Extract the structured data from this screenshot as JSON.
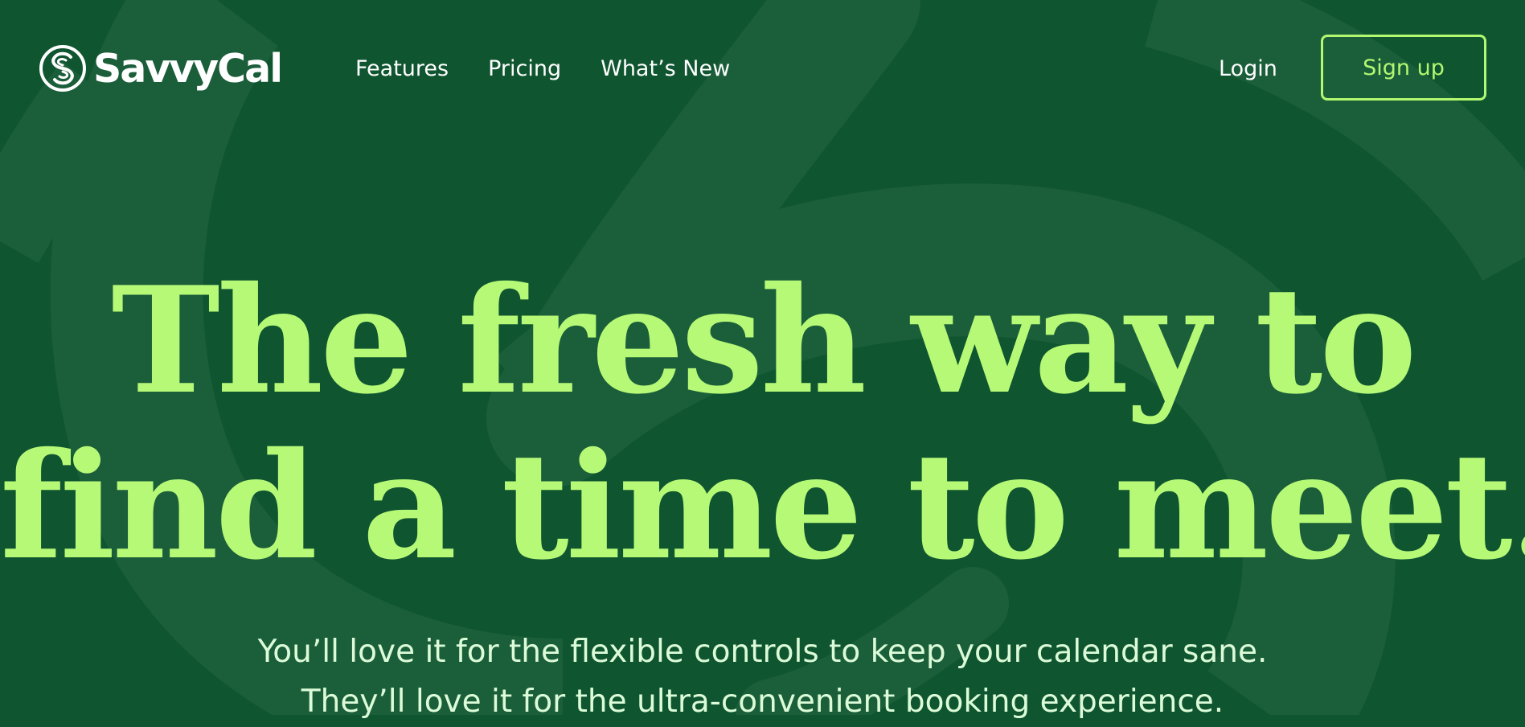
{
  "brand": {
    "name": "SavvyCal",
    "logo_icon": "savvycal-s-icon"
  },
  "nav": {
    "items": [
      {
        "label": "Features"
      },
      {
        "label": "Pricing"
      },
      {
        "label": "What’s New"
      }
    ],
    "login_label": "Login",
    "signup_label": "Sign up"
  },
  "hero": {
    "title_line1": "The fresh way to",
    "title_line2": "find a time to meet.",
    "subtitle_line1": "You’ll love it for the flexible controls to keep your calendar sane.",
    "subtitle_line2": "They’ll love it for the ultra-convenient booking experience."
  },
  "colors": {
    "background": "#0f5530",
    "swirl": "#1b5e3a",
    "accent": "#b2f870",
    "headline": "#b6f977",
    "text": "#ffffff",
    "subtitle": "#dcfbd8"
  }
}
